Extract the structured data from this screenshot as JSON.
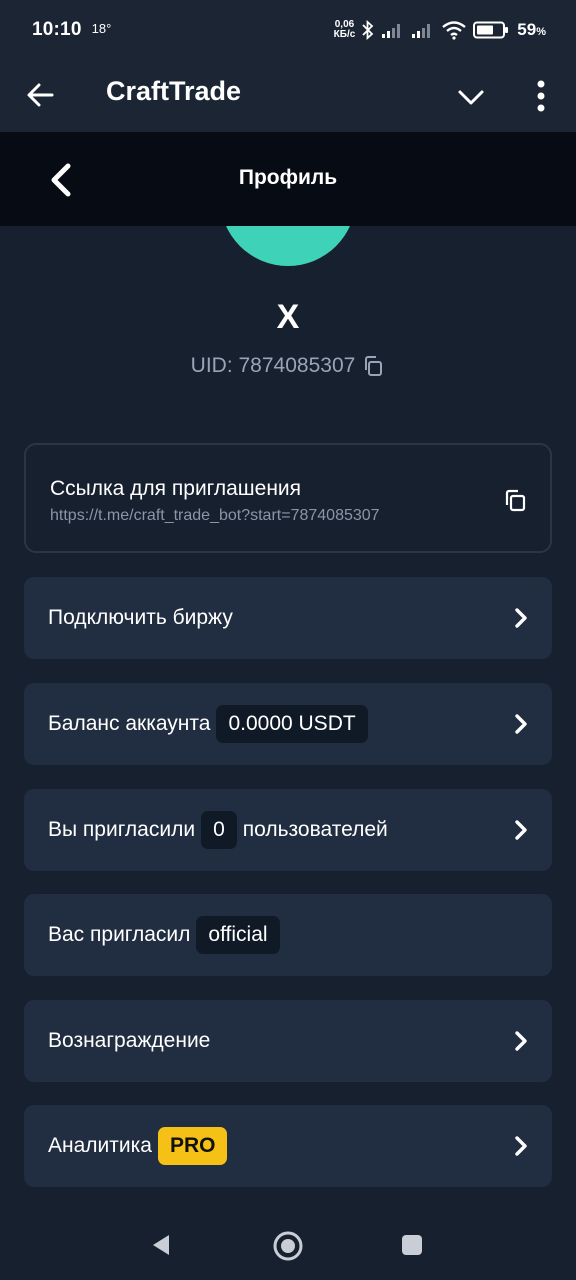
{
  "status_bar": {
    "time": "10:10",
    "temperature": "18°",
    "net_speed_value": "0,06",
    "net_speed_unit": "КБ/с",
    "battery_percent": "59",
    "battery_unit": "%"
  },
  "app_bar": {
    "title": "CraftTrade",
    "icons": [
      "back-arrow-icon",
      "chevron-down-icon",
      "more-vert-icon"
    ]
  },
  "page_header": {
    "title": "Профиль"
  },
  "profile": {
    "name": "X",
    "uid": "UID: 7874085307",
    "avatar_color": "#3ed3b8"
  },
  "invite": {
    "title": "Ссылка для приглашения",
    "link": "https://t.me/craft_trade_bot?start=7874085307"
  },
  "menu": {
    "connect_exchange": "Подключить биржу",
    "balance_label": "Баланс аккаунта",
    "balance_value": "0.0000 USDT",
    "invited_prefix": "Вы пригласили",
    "invited_count": "0",
    "invited_suffix": "пользователей",
    "invited_by_label": "Вас пригласил",
    "invited_by_value": "official",
    "reward": "Вознаграждение",
    "analytics_label": "Аналитика",
    "analytics_badge": "PRO"
  },
  "colors": {
    "background": "#16202f",
    "card": "#212d40",
    "accent_pro": "#f5c116",
    "header_dark": "#070b13"
  }
}
